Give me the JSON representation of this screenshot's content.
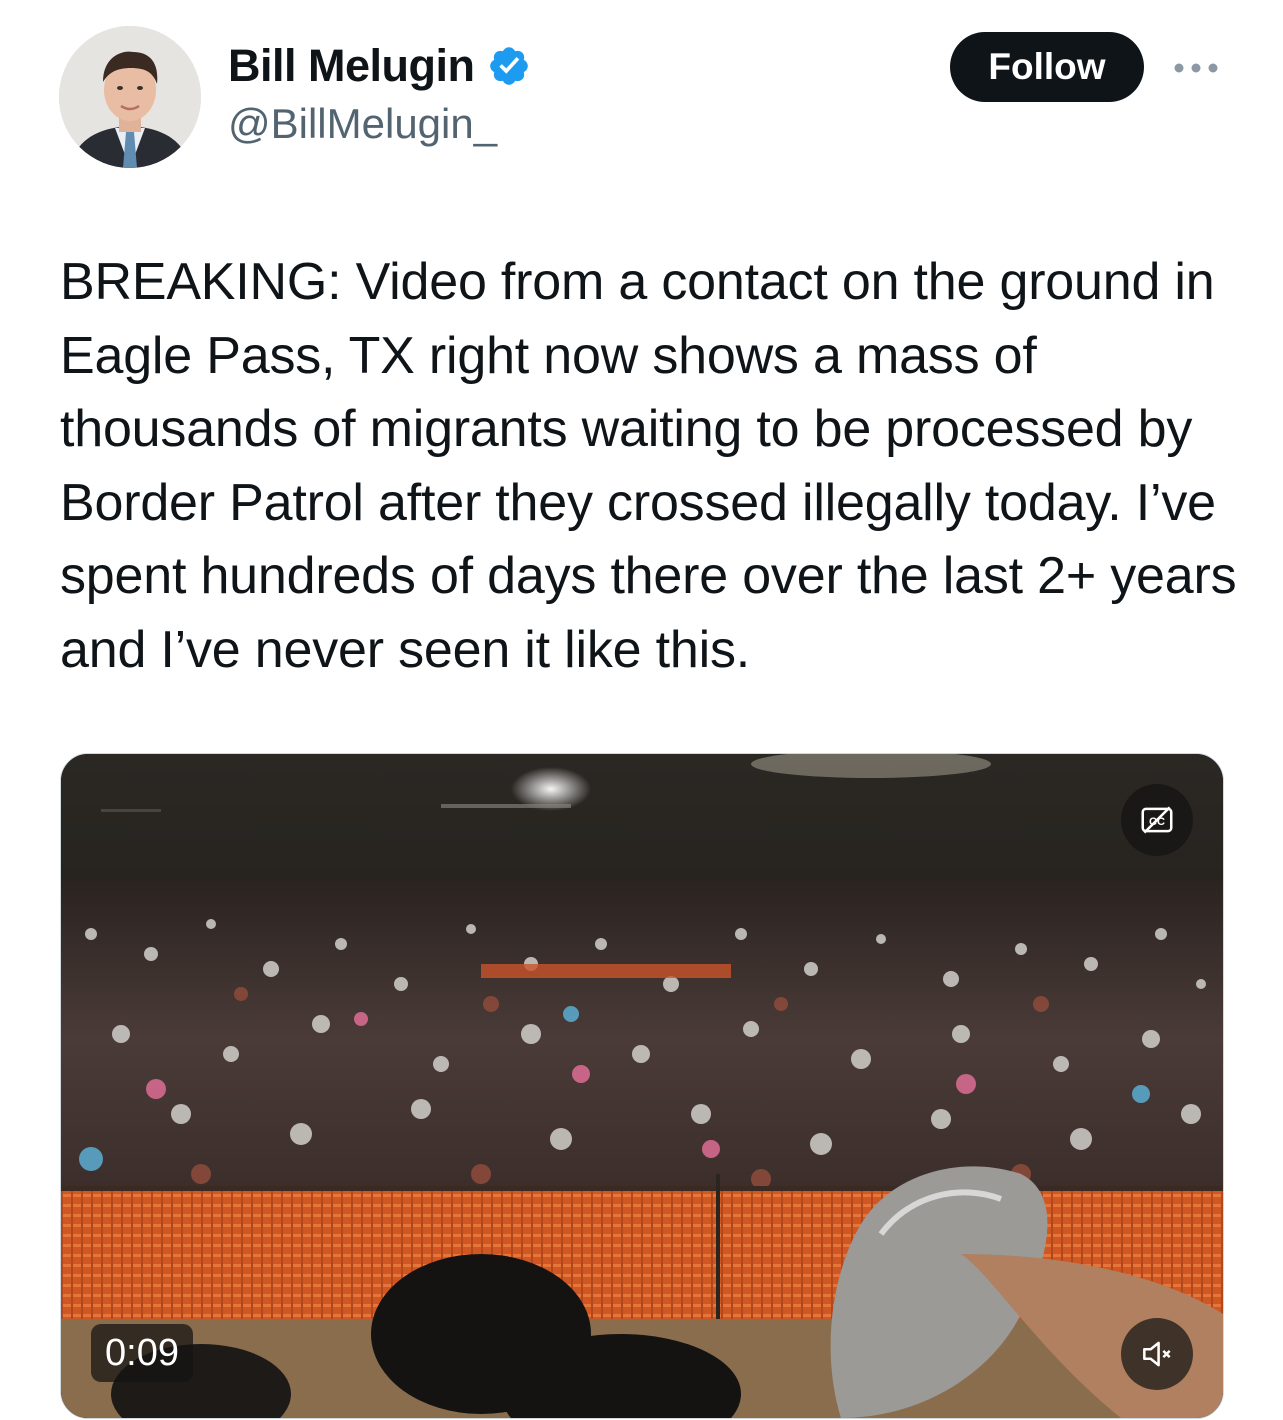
{
  "author": {
    "display_name": "Bill Melugin",
    "handle": "@BillMelugin_",
    "verified": true
  },
  "actions": {
    "follow_label": "Follow",
    "more_icon": "more-horizontal-icon"
  },
  "tweet": {
    "text": "BREAKING: Video from a contact on the ground in Eagle Pass, TX right now shows a mass of thousands of migrants waiting to be processed by Border Patrol after they crossed illegally today. I’ve spent hundreds of days there over the last 2+ years and I’ve never seen it like this."
  },
  "media": {
    "type": "video",
    "duration": "0:09",
    "captions_icon": "closed-captions-off-icon",
    "volume_icon": "volume-muted-icon"
  },
  "colors": {
    "text_primary": "#0f1419",
    "text_secondary": "#536471",
    "verified_blue": "#1d9bf0",
    "follow_bg": "#0f1419",
    "fence_orange": "#e0632b"
  }
}
